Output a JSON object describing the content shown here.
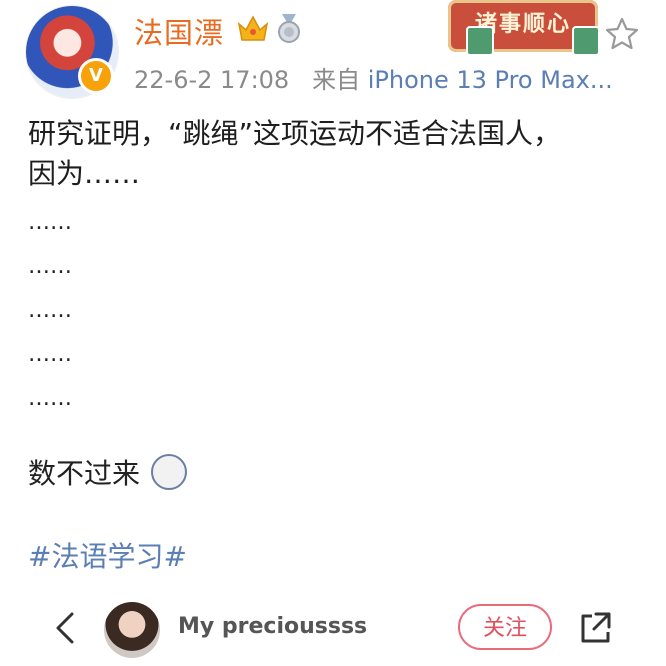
{
  "post": {
    "username": "法国漂",
    "timestamp": "22-6-2 17:08",
    "source_prefix": "来自",
    "device": "iPhone 13 Pro Max...",
    "verified_mark": "V",
    "decor_text": "诸事顺心",
    "content": {
      "line1": "研究证明，“跳绳”这项运动不适合法国人，",
      "line2": "因为……",
      "ellipses": [
        "……",
        "……",
        "……",
        "……",
        "……"
      ],
      "ending": "数不过来",
      "hashtag": "#法语学习#"
    }
  },
  "bottom_bar": {
    "user_name": "My precioussss",
    "follow_label": "关注"
  },
  "colors": {
    "username": "#e86b22",
    "link": "#5b7eb5",
    "follow": "#e0505f"
  },
  "icons": [
    "crown-icon",
    "medal-icon",
    "star-icon",
    "back-arrow-icon",
    "share-icon",
    "verified-badge-icon",
    "emoji-icon"
  ]
}
